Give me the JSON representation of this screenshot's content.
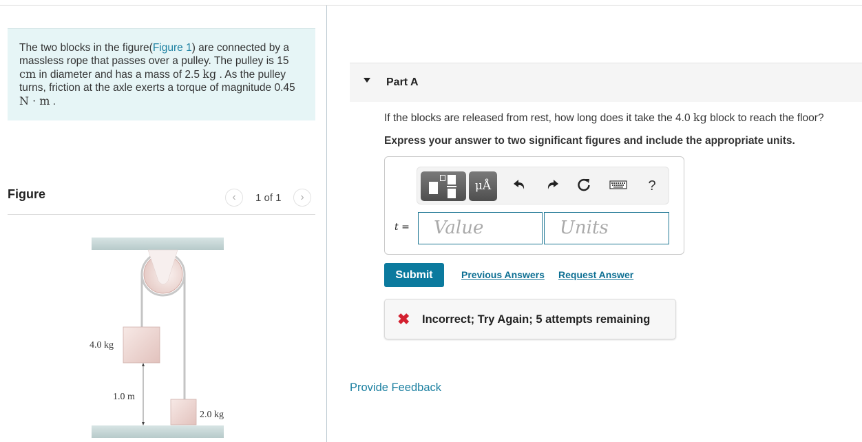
{
  "problem": {
    "text_1": "The two blocks in the figure(",
    "figure_link": "Figure 1",
    "text_2": ") are connected by a massless rope that passes over a pulley. The pulley is 15 ",
    "unit_cm": "cm",
    "text_3": " in diameter and has a mass of 2.5 ",
    "unit_kg": "kg",
    "text_4": " . As the pulley turns, friction at the axle exerts a torque of magnitude 0.45 ",
    "unit_nm": "N · m",
    "text_5": " ."
  },
  "figure": {
    "title": "Figure",
    "counter": "1 of 1",
    "prev_icon": "‹",
    "next_icon": "›",
    "labels": {
      "mass_left": "4.0 kg",
      "mass_right": "2.0 kg",
      "height": "1.0 m"
    }
  },
  "part": {
    "title": "Part A",
    "question_1": "If the blocks are released from rest, how long does it take the 4.0 ",
    "question_unit": "kg",
    "question_2": " block to reach the floor?",
    "instruction": "Express your answer to two significant figures and include the appropriate units."
  },
  "answer": {
    "variable": "t",
    "equals": " =",
    "value_placeholder": "Value",
    "units_placeholder": "Units",
    "units_button": "μÅ",
    "help_label": "?"
  },
  "actions": {
    "submit": "Submit",
    "previous_answers": "Previous Answers",
    "request_answer": "Request Answer"
  },
  "feedback": {
    "icon": "✖",
    "message": "Incorrect; Try Again; 5 attempts remaining"
  },
  "provide_feedback": "Provide Feedback",
  "colors": {
    "accent": "#0b7a9e",
    "link": "#1a7fa0",
    "error": "#d3202f",
    "problem_bg": "#e6f5f6"
  }
}
